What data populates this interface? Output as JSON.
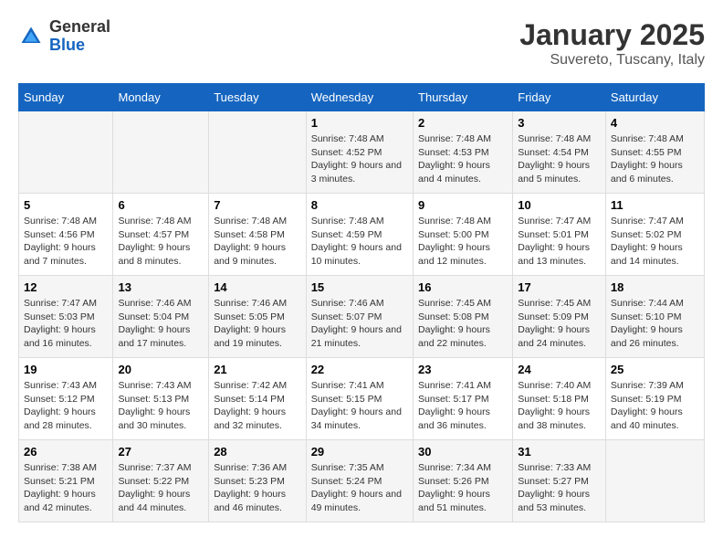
{
  "header": {
    "logo_general": "General",
    "logo_blue": "Blue",
    "title": "January 2025",
    "subtitle": "Suvereto, Tuscany, Italy"
  },
  "calendar": {
    "days_of_week": [
      "Sunday",
      "Monday",
      "Tuesday",
      "Wednesday",
      "Thursday",
      "Friday",
      "Saturday"
    ],
    "weeks": [
      [
        {
          "day": "",
          "info": ""
        },
        {
          "day": "",
          "info": ""
        },
        {
          "day": "",
          "info": ""
        },
        {
          "day": "1",
          "info": "Sunrise: 7:48 AM\nSunset: 4:52 PM\nDaylight: 9 hours and 3 minutes."
        },
        {
          "day": "2",
          "info": "Sunrise: 7:48 AM\nSunset: 4:53 PM\nDaylight: 9 hours and 4 minutes."
        },
        {
          "day": "3",
          "info": "Sunrise: 7:48 AM\nSunset: 4:54 PM\nDaylight: 9 hours and 5 minutes."
        },
        {
          "day": "4",
          "info": "Sunrise: 7:48 AM\nSunset: 4:55 PM\nDaylight: 9 hours and 6 minutes."
        }
      ],
      [
        {
          "day": "5",
          "info": "Sunrise: 7:48 AM\nSunset: 4:56 PM\nDaylight: 9 hours and 7 minutes."
        },
        {
          "day": "6",
          "info": "Sunrise: 7:48 AM\nSunset: 4:57 PM\nDaylight: 9 hours and 8 minutes."
        },
        {
          "day": "7",
          "info": "Sunrise: 7:48 AM\nSunset: 4:58 PM\nDaylight: 9 hours and 9 minutes."
        },
        {
          "day": "8",
          "info": "Sunrise: 7:48 AM\nSunset: 4:59 PM\nDaylight: 9 hours and 10 minutes."
        },
        {
          "day": "9",
          "info": "Sunrise: 7:48 AM\nSunset: 5:00 PM\nDaylight: 9 hours and 12 minutes."
        },
        {
          "day": "10",
          "info": "Sunrise: 7:47 AM\nSunset: 5:01 PM\nDaylight: 9 hours and 13 minutes."
        },
        {
          "day": "11",
          "info": "Sunrise: 7:47 AM\nSunset: 5:02 PM\nDaylight: 9 hours and 14 minutes."
        }
      ],
      [
        {
          "day": "12",
          "info": "Sunrise: 7:47 AM\nSunset: 5:03 PM\nDaylight: 9 hours and 16 minutes."
        },
        {
          "day": "13",
          "info": "Sunrise: 7:46 AM\nSunset: 5:04 PM\nDaylight: 9 hours and 17 minutes."
        },
        {
          "day": "14",
          "info": "Sunrise: 7:46 AM\nSunset: 5:05 PM\nDaylight: 9 hours and 19 minutes."
        },
        {
          "day": "15",
          "info": "Sunrise: 7:46 AM\nSunset: 5:07 PM\nDaylight: 9 hours and 21 minutes."
        },
        {
          "day": "16",
          "info": "Sunrise: 7:45 AM\nSunset: 5:08 PM\nDaylight: 9 hours and 22 minutes."
        },
        {
          "day": "17",
          "info": "Sunrise: 7:45 AM\nSunset: 5:09 PM\nDaylight: 9 hours and 24 minutes."
        },
        {
          "day": "18",
          "info": "Sunrise: 7:44 AM\nSunset: 5:10 PM\nDaylight: 9 hours and 26 minutes."
        }
      ],
      [
        {
          "day": "19",
          "info": "Sunrise: 7:43 AM\nSunset: 5:12 PM\nDaylight: 9 hours and 28 minutes."
        },
        {
          "day": "20",
          "info": "Sunrise: 7:43 AM\nSunset: 5:13 PM\nDaylight: 9 hours and 30 minutes."
        },
        {
          "day": "21",
          "info": "Sunrise: 7:42 AM\nSunset: 5:14 PM\nDaylight: 9 hours and 32 minutes."
        },
        {
          "day": "22",
          "info": "Sunrise: 7:41 AM\nSunset: 5:15 PM\nDaylight: 9 hours and 34 minutes."
        },
        {
          "day": "23",
          "info": "Sunrise: 7:41 AM\nSunset: 5:17 PM\nDaylight: 9 hours and 36 minutes."
        },
        {
          "day": "24",
          "info": "Sunrise: 7:40 AM\nSunset: 5:18 PM\nDaylight: 9 hours and 38 minutes."
        },
        {
          "day": "25",
          "info": "Sunrise: 7:39 AM\nSunset: 5:19 PM\nDaylight: 9 hours and 40 minutes."
        }
      ],
      [
        {
          "day": "26",
          "info": "Sunrise: 7:38 AM\nSunset: 5:21 PM\nDaylight: 9 hours and 42 minutes."
        },
        {
          "day": "27",
          "info": "Sunrise: 7:37 AM\nSunset: 5:22 PM\nDaylight: 9 hours and 44 minutes."
        },
        {
          "day": "28",
          "info": "Sunrise: 7:36 AM\nSunset: 5:23 PM\nDaylight: 9 hours and 46 minutes."
        },
        {
          "day": "29",
          "info": "Sunrise: 7:35 AM\nSunset: 5:24 PM\nDaylight: 9 hours and 49 minutes."
        },
        {
          "day": "30",
          "info": "Sunrise: 7:34 AM\nSunset: 5:26 PM\nDaylight: 9 hours and 51 minutes."
        },
        {
          "day": "31",
          "info": "Sunrise: 7:33 AM\nSunset: 5:27 PM\nDaylight: 9 hours and 53 minutes."
        },
        {
          "day": "",
          "info": ""
        }
      ]
    ]
  }
}
